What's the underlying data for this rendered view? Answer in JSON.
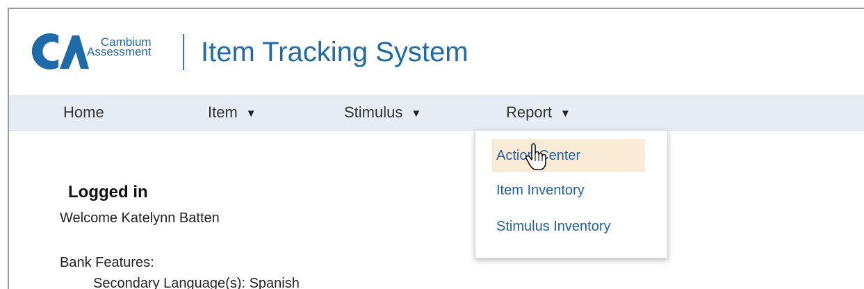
{
  "brand": {
    "logo_line1": "Cambium",
    "logo_line2": "Assessment",
    "app_title": "Item Tracking System",
    "color": "#1f6aa8"
  },
  "nav": {
    "home": "Home",
    "item": "Item",
    "stimulus": "Stimulus",
    "report": "Report",
    "caret": "▼"
  },
  "report_menu": {
    "items": [
      {
        "label": "Action Center",
        "highlighted": true
      },
      {
        "label": "Item Inventory"
      },
      {
        "label": "Stimulus Inventory"
      }
    ]
  },
  "main": {
    "heading": "Logged in",
    "welcome": "Welcome Katelynn Batten",
    "bank_features_label": "Bank Features:",
    "secondary_language": "Secondary Language(s): Spanish"
  },
  "icons": {
    "cursor": "hand-pointer-icon"
  }
}
